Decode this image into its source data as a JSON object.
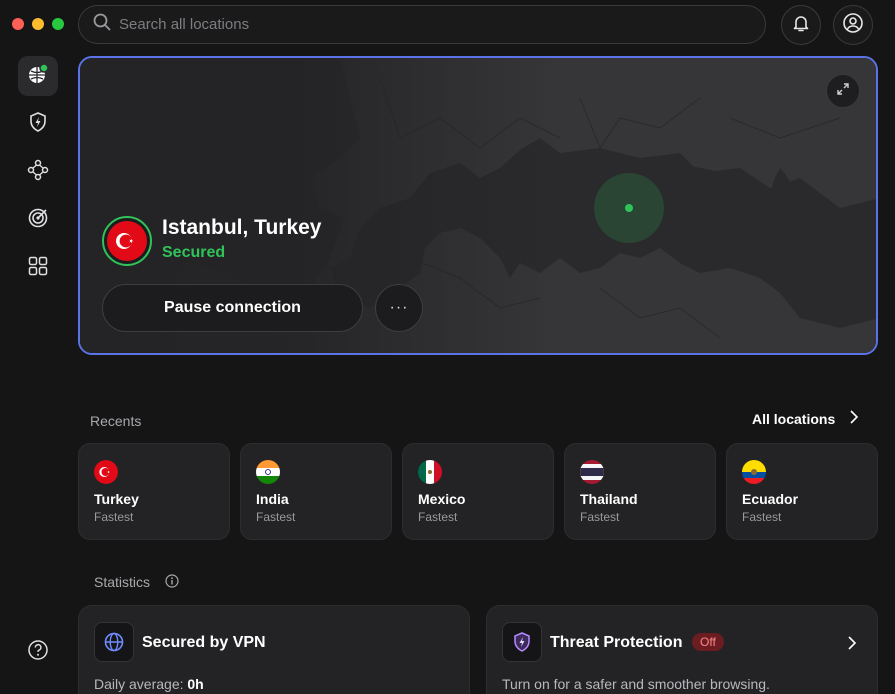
{
  "search": {
    "placeholder": "Search all locations"
  },
  "connection": {
    "location": "Istanbul, Turkey",
    "status": "Secured",
    "pause_label": "Pause connection",
    "more_label": "···"
  },
  "recents": {
    "label": "Recents",
    "all_locations_label": "All locations",
    "items": [
      {
        "name": "Turkey",
        "sub": "Fastest"
      },
      {
        "name": "India",
        "sub": "Fastest"
      },
      {
        "name": "Mexico",
        "sub": "Fastest"
      },
      {
        "name": "Thailand",
        "sub": "Fastest"
      },
      {
        "name": "Ecuador",
        "sub": "Fastest"
      }
    ]
  },
  "statistics": {
    "label": "Statistics",
    "vpn": {
      "title": "Secured by VPN",
      "line_label": "Daily average:",
      "line_value": "0h"
    },
    "threat": {
      "title": "Threat Protection",
      "badge": "Off",
      "line": "Turn on for a safer and smoother browsing."
    }
  },
  "colors": {
    "accent": "#5a73e6",
    "secured": "#2fc35a",
    "off_badge": "#6b1d22"
  },
  "icons": [
    "search-icon",
    "bell-icon",
    "profile-icon",
    "globe-icon",
    "shield-bolt-icon",
    "meshnet-icon",
    "target-icon",
    "grid-icon",
    "help-icon",
    "expand-icon",
    "chevron-right-icon",
    "info-icon"
  ]
}
